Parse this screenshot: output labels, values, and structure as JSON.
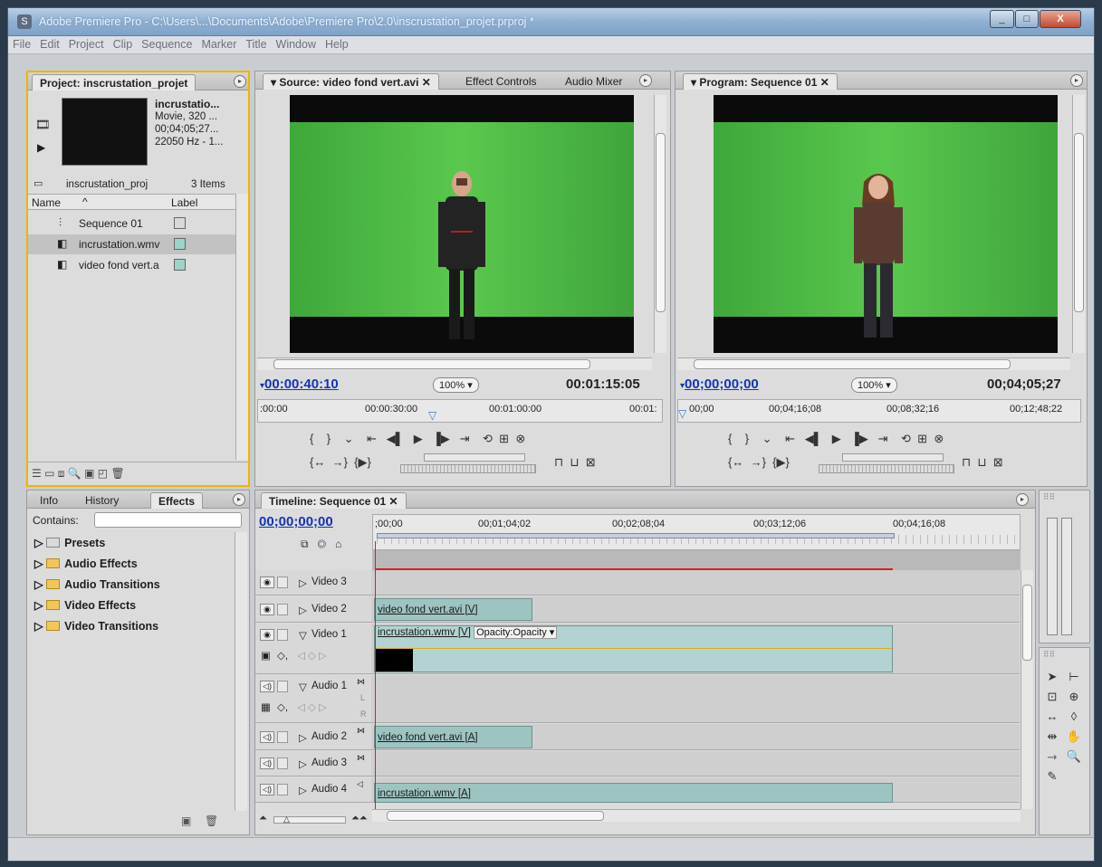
{
  "window": {
    "title": "Adobe Premiere Pro - C:\\Users\\...\\Documents\\Adobe\\Premiere Pro\\2.0\\inscrustation_projet.prproj *",
    "minimize": "_",
    "maximize": "□",
    "close": "X"
  },
  "menu": [
    "File",
    "Edit",
    "Project",
    "Clip",
    "Sequence",
    "Marker",
    "Title",
    "Window",
    "Help"
  ],
  "project": {
    "tab": "Project: inscrustation_projet",
    "clip_name": "incrustatio...",
    "clip_type": "Movie, 320 ...",
    "clip_duration": "00;04;05;27...",
    "clip_audio": "22050 Hz - 1...",
    "bin_name": "inscrustation_proj",
    "item_count": "3 Items",
    "col_name": "Name",
    "col_label": "Label",
    "items": [
      {
        "name": "Sequence 01",
        "color": "#d9d9d9"
      },
      {
        "name": "incrustation.wmv",
        "color": "#9fd3c7"
      },
      {
        "name": "video fond vert.a",
        "color": "#9fd3c7"
      }
    ]
  },
  "effects_panel": {
    "tabs": [
      "Info",
      "History",
      "Effects"
    ],
    "contains_label": "Contains:",
    "contains_value": "",
    "tree": [
      "Presets",
      "Audio Effects",
      "Audio Transitions",
      "Video Effects",
      "Video Transitions"
    ]
  },
  "source": {
    "tabs": [
      "Source: video fond vert.avi",
      "Effect Controls",
      "Audio Mixer"
    ],
    "timecode_in": "00:00:40:10",
    "zoom": "100%",
    "duration": "00:01:15:05",
    "ruler": [
      ":00:00",
      "00:00:30:00",
      "00:01:00:00",
      "00:01:"
    ]
  },
  "program": {
    "tab": "Program: Sequence 01",
    "timecode_in": "00;00;00;00",
    "zoom": "100%",
    "duration": "00;04;05;27",
    "ruler": [
      "00;00",
      "00;04;16;08",
      "00;08;32;16",
      "00;12;48;22"
    ]
  },
  "timeline": {
    "tab": "Timeline: Sequence 01",
    "timecode": "00;00;00;00",
    "ruler": [
      ";00;00",
      "00;01;04;02",
      "00;02;08;04",
      "00;03;12;06",
      "00;04;16;08"
    ],
    "tracks": {
      "video3": "Video 3",
      "video2": "Video 2",
      "video1": "Video 1",
      "audio1": "Audio 1",
      "audio2": "Audio 2",
      "audio3": "Audio 3",
      "audio4": "Audio 4"
    },
    "clips": {
      "v2": "video fond vert.avi [V]",
      "v1": "incrustation.wmv [V]",
      "v1_fx": "Opacity:Opacity",
      "a2": "video fond vert.avi [A]",
      "a4": "incrustation.wmv [A]"
    },
    "audio_lr": [
      "L",
      "R"
    ]
  },
  "colors": {
    "project_highlight": "#f0b400",
    "clip": "#9ec4c2",
    "playhead": "#d42020",
    "timecode_blue": "#1434b8",
    "green_screen": "#4cb944"
  }
}
